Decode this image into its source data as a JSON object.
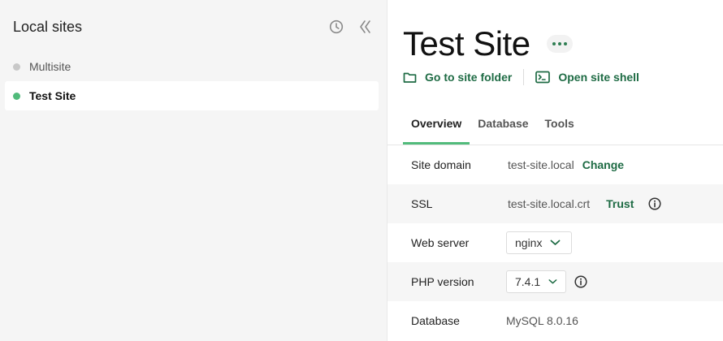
{
  "sidebar": {
    "title": "Local sites",
    "icons": {
      "history": "clock-icon",
      "collapse": "double-chevron-left-icon"
    },
    "sites": [
      {
        "name": "Multisite",
        "status": "stopped"
      },
      {
        "name": "Test Site",
        "status": "running"
      }
    ]
  },
  "site": {
    "title": "Test Site",
    "links": {
      "folder": "Go to site folder",
      "shell": "Open site shell"
    },
    "tabs": [
      "Overview",
      "Database",
      "Tools"
    ],
    "active_tab": "Overview",
    "overview": {
      "domain": {
        "label": "Site domain",
        "value": "test-site.local",
        "action": "Change"
      },
      "ssl": {
        "label": "SSL",
        "value": "test-site.local.crt",
        "action": "Trust"
      },
      "web_server": {
        "label": "Web server",
        "value": "nginx"
      },
      "php": {
        "label": "PHP version",
        "value": "7.4.1"
      },
      "database": {
        "label": "Database",
        "value": "MySQL 8.0.16"
      }
    }
  },
  "colors": {
    "accent": "#51bb7b",
    "link": "#1e6b44",
    "sidebar_bg": "#f5f5f5"
  }
}
